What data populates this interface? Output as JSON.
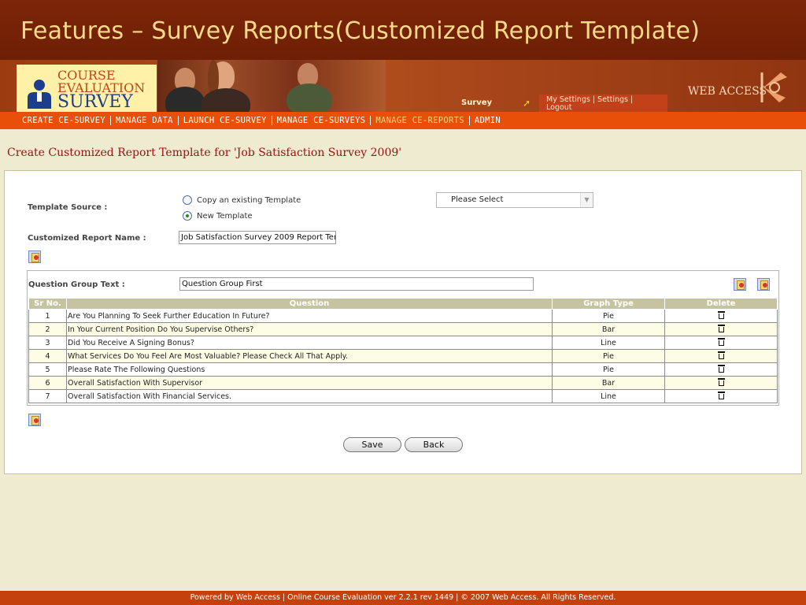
{
  "header": {
    "title": "Features – Survey Reports(Customized Report Template)"
  },
  "logo": {
    "line1": "COURSE",
    "line2": "EVALUATION",
    "line3": "SURVEY"
  },
  "banner": {
    "survey_label": "Survey",
    "settings_line1": "My Settings | Settings |",
    "settings_line2": "Logout",
    "brand": "WEB ACCESS"
  },
  "nav": {
    "items": [
      "CREATE CE-SURVEY",
      "MANAGE DATA",
      "LAUNCH CE-SURVEY",
      "MANAGE CE-SURVEYS",
      "MANAGE CE-REPORTS",
      "ADMIN"
    ],
    "active": "MANAGE CE-REPORTS"
  },
  "page": {
    "heading": "Create Customized Report Template  for 'Job Satisfaction Survey 2009'"
  },
  "form": {
    "template_source_label": "Template Source :",
    "option_copy": "Copy an existing Template",
    "option_new": "New Template",
    "selected_option": "New Template",
    "select_value": "Please Select",
    "report_name_label": "Customized Report Name :",
    "report_name_value": "Job Satisfaction Survey 2009 Report Tem",
    "group_text_label": "Question Group Text :",
    "group_text_value": "Question Group First"
  },
  "table": {
    "headers": [
      "Sr No.",
      "Question",
      "Graph Type",
      "Delete"
    ],
    "rows": [
      {
        "sr": "1",
        "question": "Are You Planning To Seek Further Education In Future?",
        "graph": "Pie"
      },
      {
        "sr": "2",
        "question": "In Your Current Position Do You Supervise Others?",
        "graph": "Bar"
      },
      {
        "sr": "3",
        "question": "Did You Receive A Signing Bonus?",
        "graph": "Line"
      },
      {
        "sr": "4",
        "question": "What Services Do You Feel Are Most Valuable? Please Check All That Apply.",
        "graph": "Pie"
      },
      {
        "sr": "5",
        "question": "Please Rate The Following Questions",
        "graph": "Pie"
      },
      {
        "sr": "6",
        "question": "Overall Satisfaction With Supervisor",
        "graph": "Bar"
      },
      {
        "sr": "7",
        "question": "Overall Satisfaction With Financial Services.",
        "graph": "Line"
      }
    ]
  },
  "buttons": {
    "save": "Save",
    "back": "Back"
  },
  "footer": {
    "text": "Powered by Web Access | Online Course Evaluation ver 2.2.1 rev 1449 | © 2007 Web Access. All Rights Reserved."
  },
  "colors": {
    "title_bar": "#7d2508",
    "nav_bar": "#e8500a",
    "heading": "#a01010",
    "table_header": "#c6c4a0",
    "footer": "#c4410e"
  }
}
